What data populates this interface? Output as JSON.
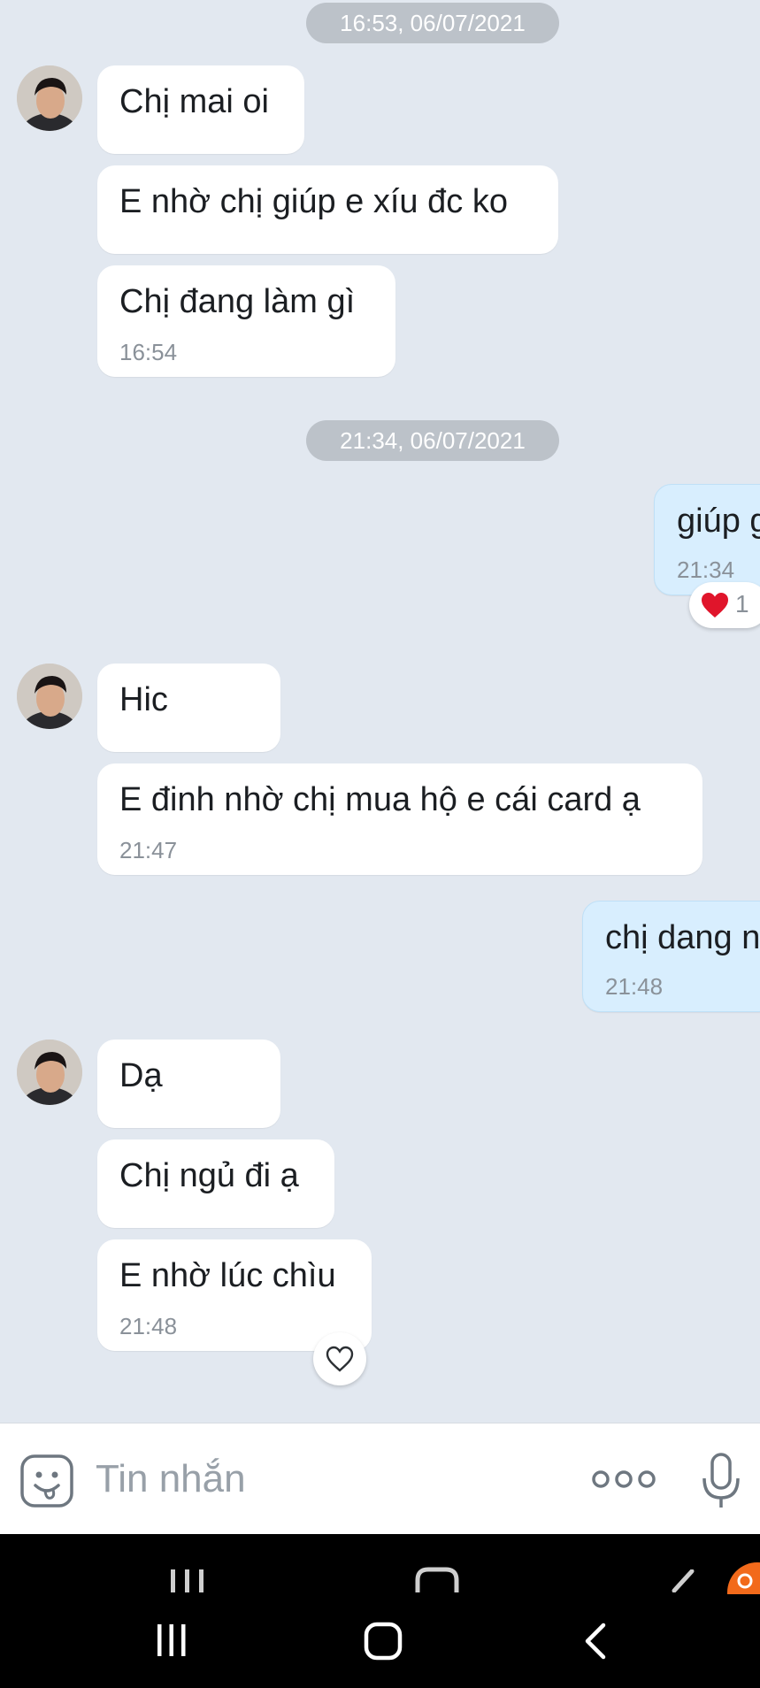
{
  "conversation": {
    "stamps": [
      "16:53, 06/07/2021",
      "21:34, 06/07/2021"
    ],
    "messages": [
      {
        "text": "Chị mai oi"
      },
      {
        "text": "E nhờ chị giúp e xíu đc ko"
      },
      {
        "text": "Chị đang làm gì",
        "time": "16:54"
      },
      {
        "text": "giúp g",
        "time": "21:34",
        "reaction": {
          "icon": "heart-icon",
          "count": "1"
        }
      },
      {
        "text": "Hic"
      },
      {
        "text": "E đinh nhờ chị mua hộ e cái card ạ",
        "time": "21:47"
      },
      {
        "text": "chị dang n",
        "time": "21:48"
      },
      {
        "text": "Dạ"
      },
      {
        "text": "Chị ngủ đi ạ"
      },
      {
        "text": "E nhờ lúc chìu",
        "time": "21:48"
      }
    ]
  },
  "composer": {
    "placeholder": "Tin nhắn",
    "icons": [
      "sticker-icon",
      "more-icon",
      "microphone-icon"
    ]
  },
  "nav_bar": {
    "icons": [
      "recent-apps-icon",
      "home-icon",
      "back-icon"
    ]
  },
  "colors": {
    "background": "#e2e8f0",
    "outgoing_bubble": "#d8eefe",
    "incoming_bubble": "#ffffff",
    "reaction_heart": "#e0152b",
    "notification": "#f26a1b"
  }
}
